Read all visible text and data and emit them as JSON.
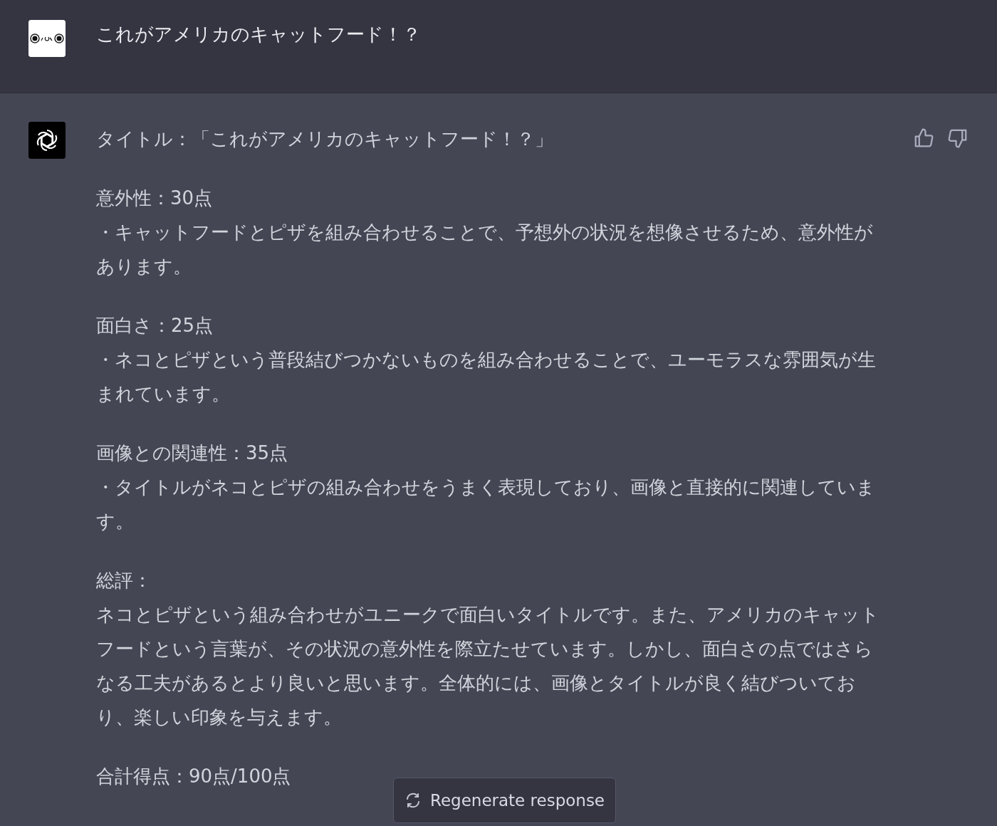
{
  "user_message": {
    "text": "これがアメリカのキャットフード！？"
  },
  "assistant_message": {
    "title": "タイトル：「これがアメリカのキャットフード！？」",
    "sections": [
      {
        "heading": "意外性：30点",
        "body": "・キャットフードとピザを組み合わせることで、予想外の状況を想像させるため、意外性があります。"
      },
      {
        "heading": "面白さ：25点",
        "body": "・ネコとピザという普段結びつかないものを組み合わせることで、ユーモラスな雰囲気が生まれています。"
      },
      {
        "heading": "画像との関連性：35点",
        "body": "・タイトルがネコとピザの組み合わせをうまく表現しており、画像と直接的に関連しています。"
      },
      {
        "heading": "総評：",
        "body": "ネコとピザという組み合わせがユニークで面白いタイトルです。また、アメリカのキャットフードという言葉が、その状況の意外性を際立たせています。しかし、面白さの点ではさらなる工夫があるとより良いと思います。全体的には、画像とタイトルが良く結びついており、楽しい印象を与えます。"
      }
    ],
    "total": "合計得点：90点/100点"
  },
  "regenerate_button": {
    "label": "Regenerate response"
  }
}
